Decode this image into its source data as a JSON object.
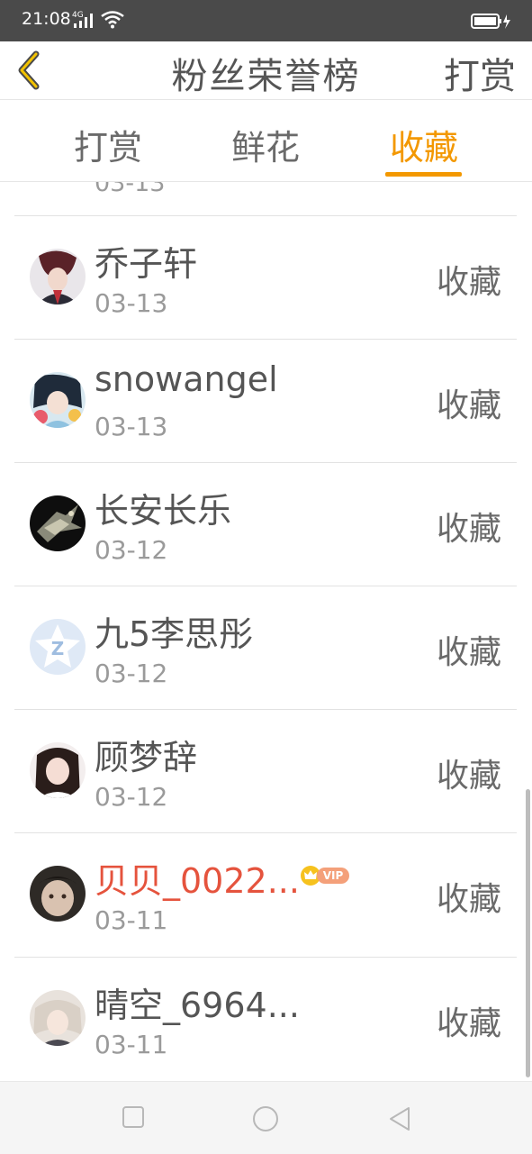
{
  "status_bar": {
    "time": "21:08",
    "network": "4G"
  },
  "header": {
    "title": "粉丝荣誉榜",
    "right_action": "打赏"
  },
  "tabs": [
    {
      "label": "打赏",
      "active": false
    },
    {
      "label": "鲜花",
      "active": false
    },
    {
      "label": "收藏",
      "active": true
    }
  ],
  "colors": {
    "accent": "#f39800",
    "vip_name": "#e5533d",
    "text": "#555555",
    "muted": "#9a9a9a"
  },
  "list": {
    "partial_top_date": "03-13",
    "items": [
      {
        "name": "乔子轩",
        "date": "03-13",
        "action": "收藏",
        "vip": false
      },
      {
        "name": "snowangel",
        "date": "03-13",
        "action": "收藏",
        "vip": false
      },
      {
        "name": "长安长乐",
        "date": "03-12",
        "action": "收藏",
        "vip": false
      },
      {
        "name": "九5李思彤",
        "date": "03-12",
        "action": "收藏",
        "vip": false
      },
      {
        "name": "顾梦辞",
        "date": "03-12",
        "action": "收藏",
        "vip": false
      },
      {
        "name": "贝贝_0022...",
        "date": "03-11",
        "action": "收藏",
        "vip": true,
        "vip_label": "VIP"
      },
      {
        "name": "晴空_6964...",
        "date": "03-11",
        "action": "收藏",
        "vip": false
      }
    ]
  },
  "icons": {
    "back": "chevron-left-icon",
    "wifi": "wifi-icon",
    "battery": "battery-icon",
    "nav_recent": "square-icon",
    "nav_home": "circle-icon",
    "nav_back": "triangle-back-icon"
  }
}
